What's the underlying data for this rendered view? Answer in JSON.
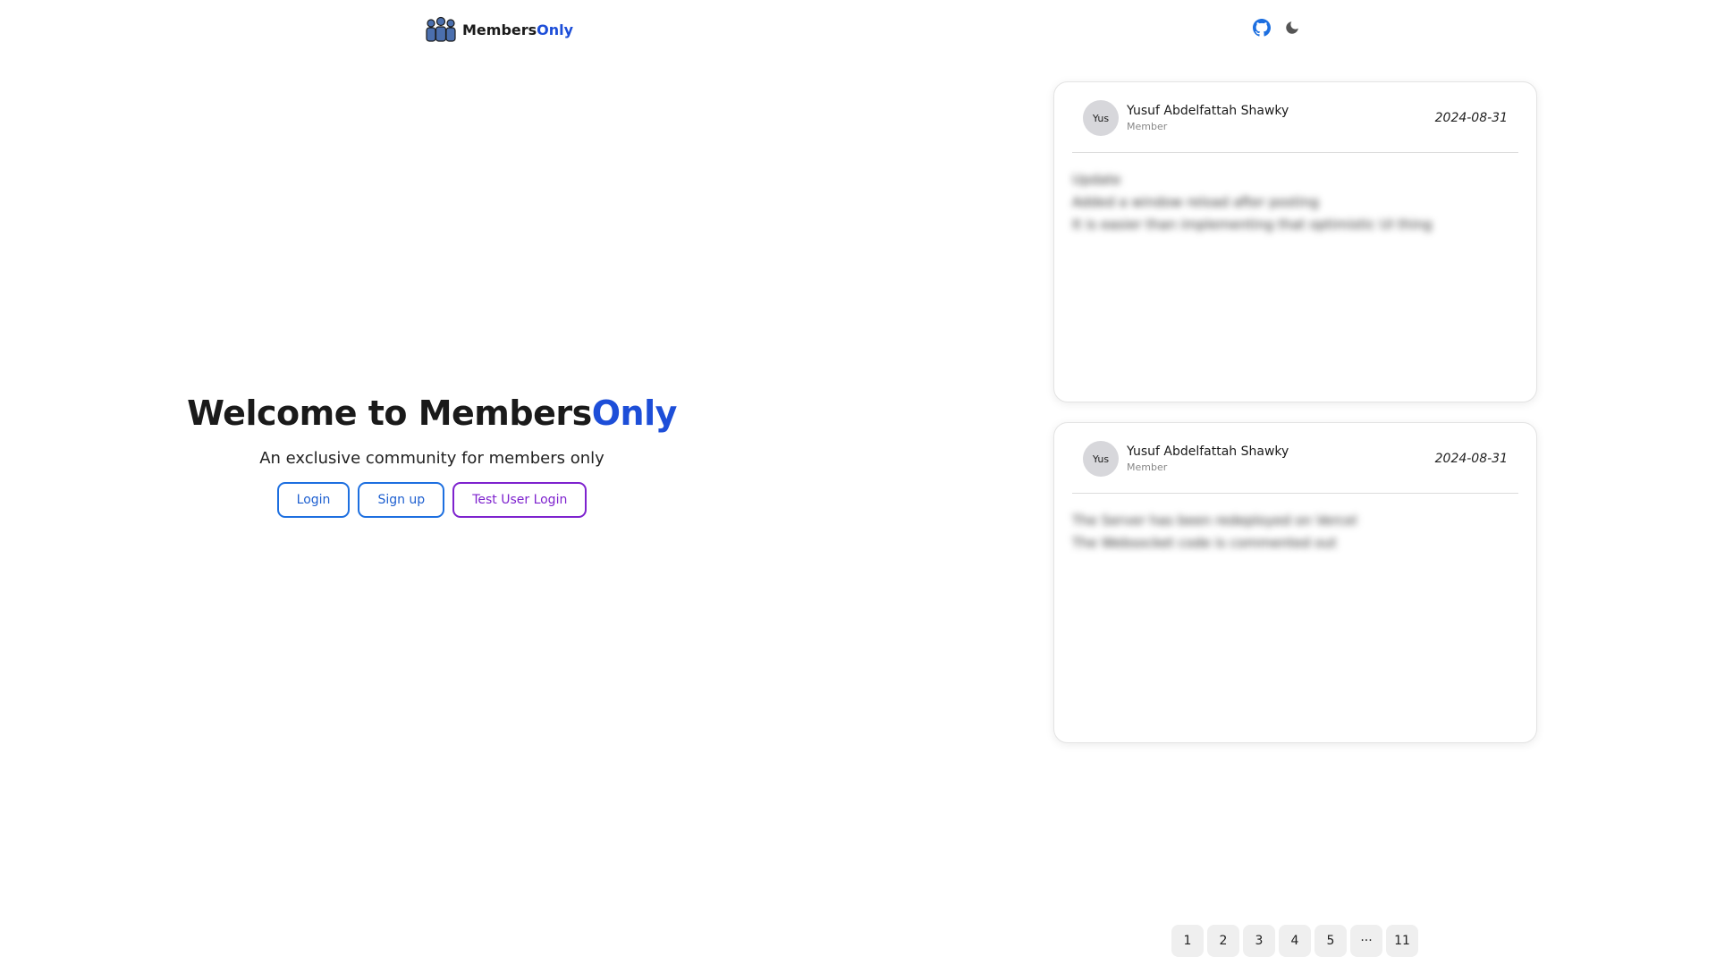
{
  "header": {
    "logo_text_main": "Members",
    "logo_text_accent": "Only",
    "github_icon": "github-icon",
    "theme_icon": "moon-icon"
  },
  "hero": {
    "title_main": "Welcome to Members",
    "title_accent": "Only",
    "subtitle": "An exclusive community for members only",
    "login_label": "Login",
    "signup_label": "Sign up",
    "test_login_label": "Test User Login"
  },
  "posts": [
    {
      "avatar": "Yus",
      "author": "Yusuf Abdelfattah Shawky",
      "role": "Member",
      "date": "2024-08-31",
      "lines": [
        "Update",
        "Added a window reload after posting",
        "It is easier than implementing that optimistic UI thing"
      ]
    },
    {
      "avatar": "Yus",
      "author": "Yusuf Abdelfattah Shawky",
      "role": "Member",
      "date": "2024-08-31",
      "lines": [
        "The Server has been redeployed on Vercel",
        "The Websocket code is commented out"
      ]
    }
  ],
  "pagination": [
    "1",
    "2",
    "3",
    "4",
    "5",
    "···",
    "11"
  ],
  "colors": {
    "accent": "#1d4ed8",
    "button_blue": "#1d6fe0",
    "button_purple": "#7e22ce"
  }
}
